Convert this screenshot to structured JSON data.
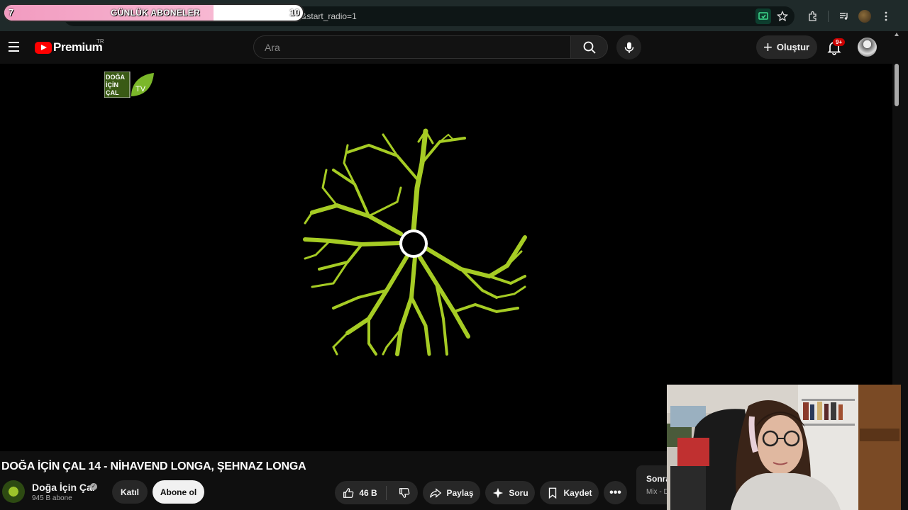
{
  "browser": {
    "url_fragment": "U&list=RDhET-pt6R-TU&start_radio=1"
  },
  "stream_overlay": {
    "current": "7",
    "goal": "10",
    "label": "GÜNLÜK ABONELER",
    "progress": 0.7
  },
  "header": {
    "logo_text": "Premium",
    "country": "TR",
    "search_placeholder": "Ara",
    "create_label": "Oluştur",
    "notification_count": "9+"
  },
  "video": {
    "title": "DOĞA İÇİN ÇAL 14 - NİHAVEND LONGA, ŞEHNAZ LONGA",
    "channel_logo_lines": [
      "DOĞA",
      "İÇİN",
      "ÇAL"
    ],
    "channel_logo_tv": "TV",
    "channel_name": "Doğa İçin Çal",
    "subscribers": "945 B abone",
    "join_label": "Katıl",
    "subscribe_label": "Abone ol",
    "like_count": "46 B",
    "share_label": "Paylaş",
    "ask_label": "Soru",
    "save_label": "Kaydet"
  },
  "up_next": {
    "title": "Sonra",
    "subtitle": "Mix - D"
  },
  "colors": {
    "youtube_red": "#ff0000",
    "tree_green": "#a6cc24",
    "overlay_pink": "#f29bc0"
  }
}
